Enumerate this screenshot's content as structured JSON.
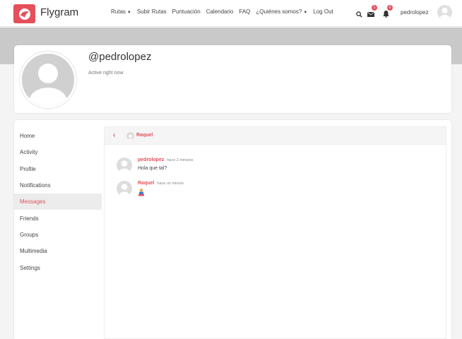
{
  "header": {
    "logo_text": "Flygram",
    "nav": [
      {
        "label": "Rutas",
        "dropdown": true
      },
      {
        "label": "Subir Rutas",
        "dropdown": false
      },
      {
        "label": "Puntuación",
        "dropdown": false
      },
      {
        "label": "Calendario",
        "dropdown": false
      },
      {
        "label": "FAQ",
        "dropdown": false
      },
      {
        "label": "¿Quiénes somos?",
        "dropdown": true
      },
      {
        "label": "Log Out",
        "dropdown": false
      }
    ],
    "messages_badge": "1",
    "notifications_badge": "0",
    "username": "pedrolopez"
  },
  "profile": {
    "handle": "@pedrolopez",
    "status": "Active right now"
  },
  "sidebar": {
    "items": [
      {
        "label": "Home",
        "active": false
      },
      {
        "label": "Activity",
        "active": false
      },
      {
        "label": "Profile",
        "active": false
      },
      {
        "label": "Notifications",
        "active": false
      },
      {
        "label": "Messages",
        "active": true
      },
      {
        "label": "Friends",
        "active": false
      },
      {
        "label": "Groups",
        "active": false
      },
      {
        "label": "Multimedia",
        "active": false
      },
      {
        "label": "Settings",
        "active": false
      }
    ]
  },
  "thread": {
    "back_icon": "chevron-left-icon",
    "recipient": "Raquel",
    "messages": [
      {
        "author": "pedrolopez",
        "time": "hace 2 minutos",
        "text": "Hola que tal?"
      },
      {
        "author": "Raquel",
        "time": "hace un minuto",
        "text": "",
        "emoji": "person-icon"
      }
    ]
  },
  "colors": {
    "accent": "#e5505a",
    "cover": "#c9c9c9",
    "background": "#f4f4f4"
  }
}
